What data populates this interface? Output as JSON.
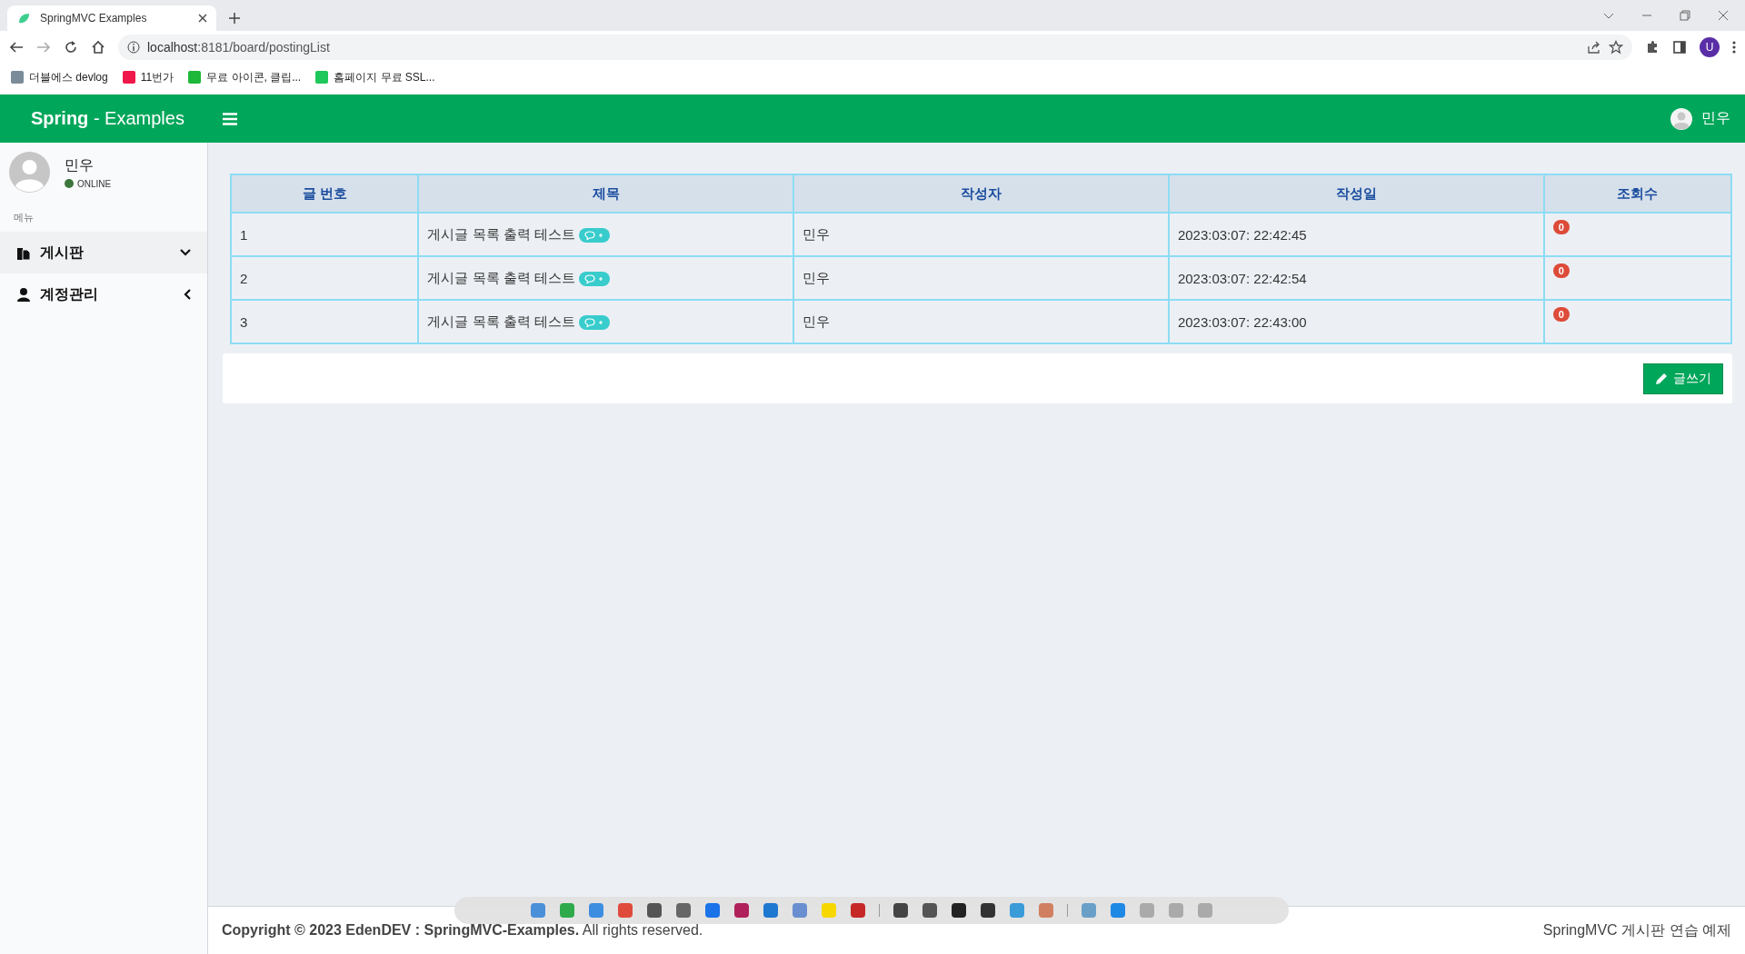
{
  "browser": {
    "tab": {
      "title": "SpringMVC Examples"
    },
    "url": {
      "host": "localhost",
      "rest": ":8181/board/postingList"
    },
    "profile": "U",
    "bookmarks": [
      {
        "label": "더블에스 devlog",
        "color": "#7a8c9a"
      },
      {
        "label": "11번가",
        "color": "#f0184a"
      },
      {
        "label": "무료 아이콘, 클립...",
        "color": "#1db83a"
      },
      {
        "label": "홈페이지 무료 SSL...",
        "color": "#1ec85a"
      }
    ]
  },
  "header": {
    "brand_bold": "Spring",
    "brand_rest": " - Examples",
    "user": "민우"
  },
  "sidebar": {
    "user": "민우",
    "status": "ONLINE",
    "section": "메뉴",
    "items": [
      {
        "label": "게시판",
        "kind": "board",
        "expanded": true
      },
      {
        "label": "계정관리",
        "kind": "account",
        "expanded": false
      }
    ]
  },
  "table": {
    "columns": [
      "글 번호",
      "제목",
      "작성자",
      "작성일",
      "조회수"
    ],
    "rows": [
      {
        "no": "1",
        "title": "게시글 목록 출력 테스트",
        "author": "민우",
        "date": "2023:03:07: 22:42:45",
        "views": "0"
      },
      {
        "no": "2",
        "title": "게시글 목록 출력 테스트",
        "author": "민우",
        "date": "2023:03:07: 22:42:54",
        "views": "0"
      },
      {
        "no": "3",
        "title": "게시글 목록 출력 테스트",
        "author": "민우",
        "date": "2023:03:07: 22:43:00",
        "views": "0"
      }
    ]
  },
  "write_button": "글쓰기",
  "footer": {
    "copyright": "**Copyright © 2023 EdenDEV : SpringMVC-Examples.** All rights reserved.",
    "right": "SpringMVC 게시판 연습 예제"
  }
}
